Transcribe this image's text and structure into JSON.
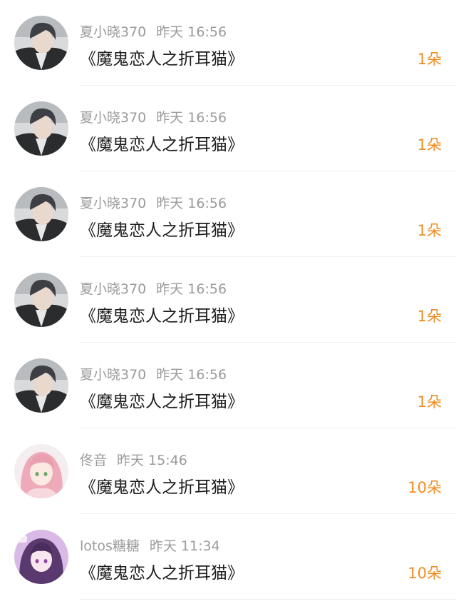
{
  "accent_color": "#f08a1e",
  "items": [
    {
      "user": "夏小晓370",
      "time": "昨天 16:56",
      "title": "《魔鬼恋人之折耳猫》",
      "gift": "1朵",
      "avatar": "man-dark-hair-icon"
    },
    {
      "user": "夏小晓370",
      "time": "昨天 16:56",
      "title": "《魔鬼恋人之折耳猫》",
      "gift": "1朵",
      "avatar": "man-dark-hair-icon"
    },
    {
      "user": "夏小晓370",
      "time": "昨天 16:56",
      "title": "《魔鬼恋人之折耳猫》",
      "gift": "1朵",
      "avatar": "man-dark-hair-icon"
    },
    {
      "user": "夏小晓370",
      "time": "昨天 16:56",
      "title": "《魔鬼恋人之折耳猫》",
      "gift": "1朵",
      "avatar": "man-dark-hair-icon"
    },
    {
      "user": "夏小晓370",
      "time": "昨天 16:56",
      "title": "《魔鬼恋人之折耳猫》",
      "gift": "1朵",
      "avatar": "man-dark-hair-icon"
    },
    {
      "user": "佟音",
      "time": "昨天 15:46",
      "title": "《魔鬼恋人之折耳猫》",
      "gift": "10朵",
      "avatar": "girl-pink-hair-icon"
    },
    {
      "user": "lotos糖糖",
      "time": "昨天 11:34",
      "title": "《魔鬼恋人之折耳猫》",
      "gift": "10朵",
      "avatar": "girl-purple-hair-icon"
    }
  ]
}
